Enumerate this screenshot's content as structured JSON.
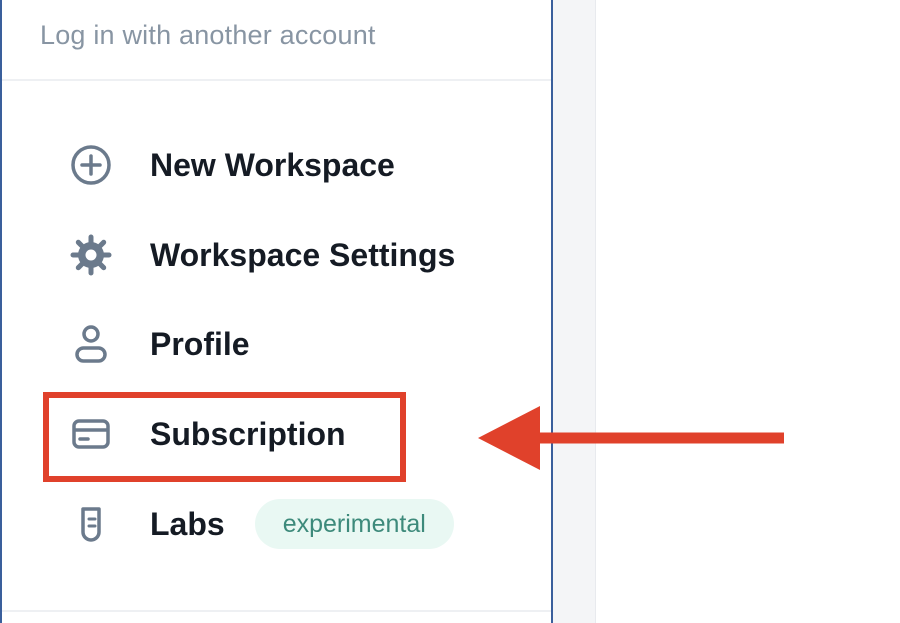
{
  "account_menu": {
    "alt_login_label": "Log in with another account",
    "items": [
      {
        "label": "New Workspace",
        "icon": "plus-circle-icon"
      },
      {
        "label": "Workspace Settings",
        "icon": "gear-icon"
      },
      {
        "label": "Profile",
        "icon": "user-icon"
      },
      {
        "label": "Subscription",
        "icon": "credit-card-icon"
      },
      {
        "label": "Labs",
        "icon": "test-tube-icon",
        "badge": "experimental"
      }
    ]
  },
  "colors": {
    "icon": "#6b7a8c",
    "label": "#151b24",
    "highlight": "#e0412b",
    "badge_bg": "#e9f8f3",
    "badge_text": "#3d8a7b",
    "panel_border": "#3a5f9c"
  }
}
